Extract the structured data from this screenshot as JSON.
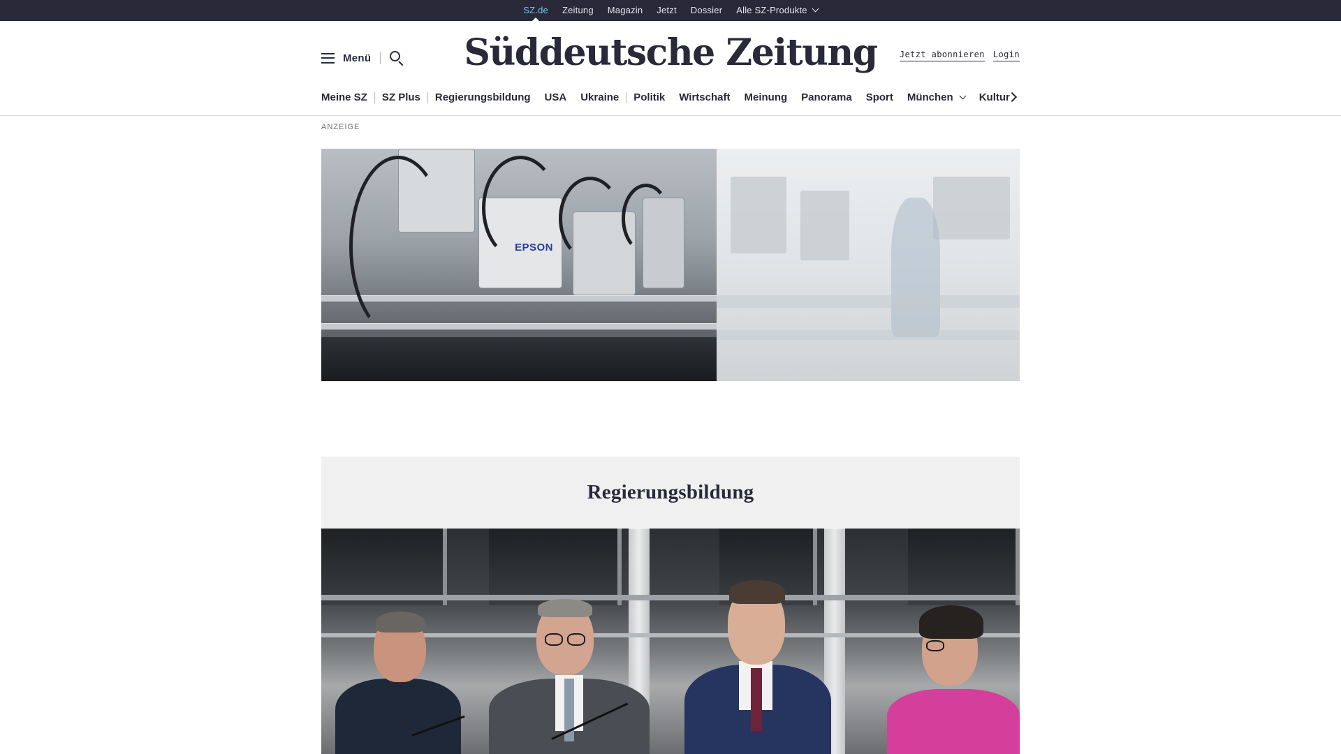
{
  "topbar": {
    "links": [
      "SZ.de",
      "Zeitung",
      "Magazin",
      "Jetzt",
      "Dossier",
      "Alle SZ-Produkte"
    ]
  },
  "header": {
    "menu_label": "Menü",
    "logo_text": "Süddeutsche Zeitung",
    "subscribe_label": "Jetzt abonnieren",
    "login_label": "Login"
  },
  "nav": {
    "items": [
      "Meine SZ",
      "SZ Plus",
      "Regierungsbildung",
      "USA",
      "Ukraine",
      "Politik",
      "Wirtschaft",
      "Meinung",
      "Panorama",
      "Sport",
      "München",
      "Kultur"
    ]
  },
  "ad": {
    "label": "ANZEIGE",
    "brand": "EPSON"
  },
  "section": {
    "title": "Regierungsbildung"
  },
  "colors": {
    "topbar_bg": "#29293a",
    "active_link": "#71c5e8",
    "text": "#29293a",
    "section_bg": "#f0f0f0"
  }
}
